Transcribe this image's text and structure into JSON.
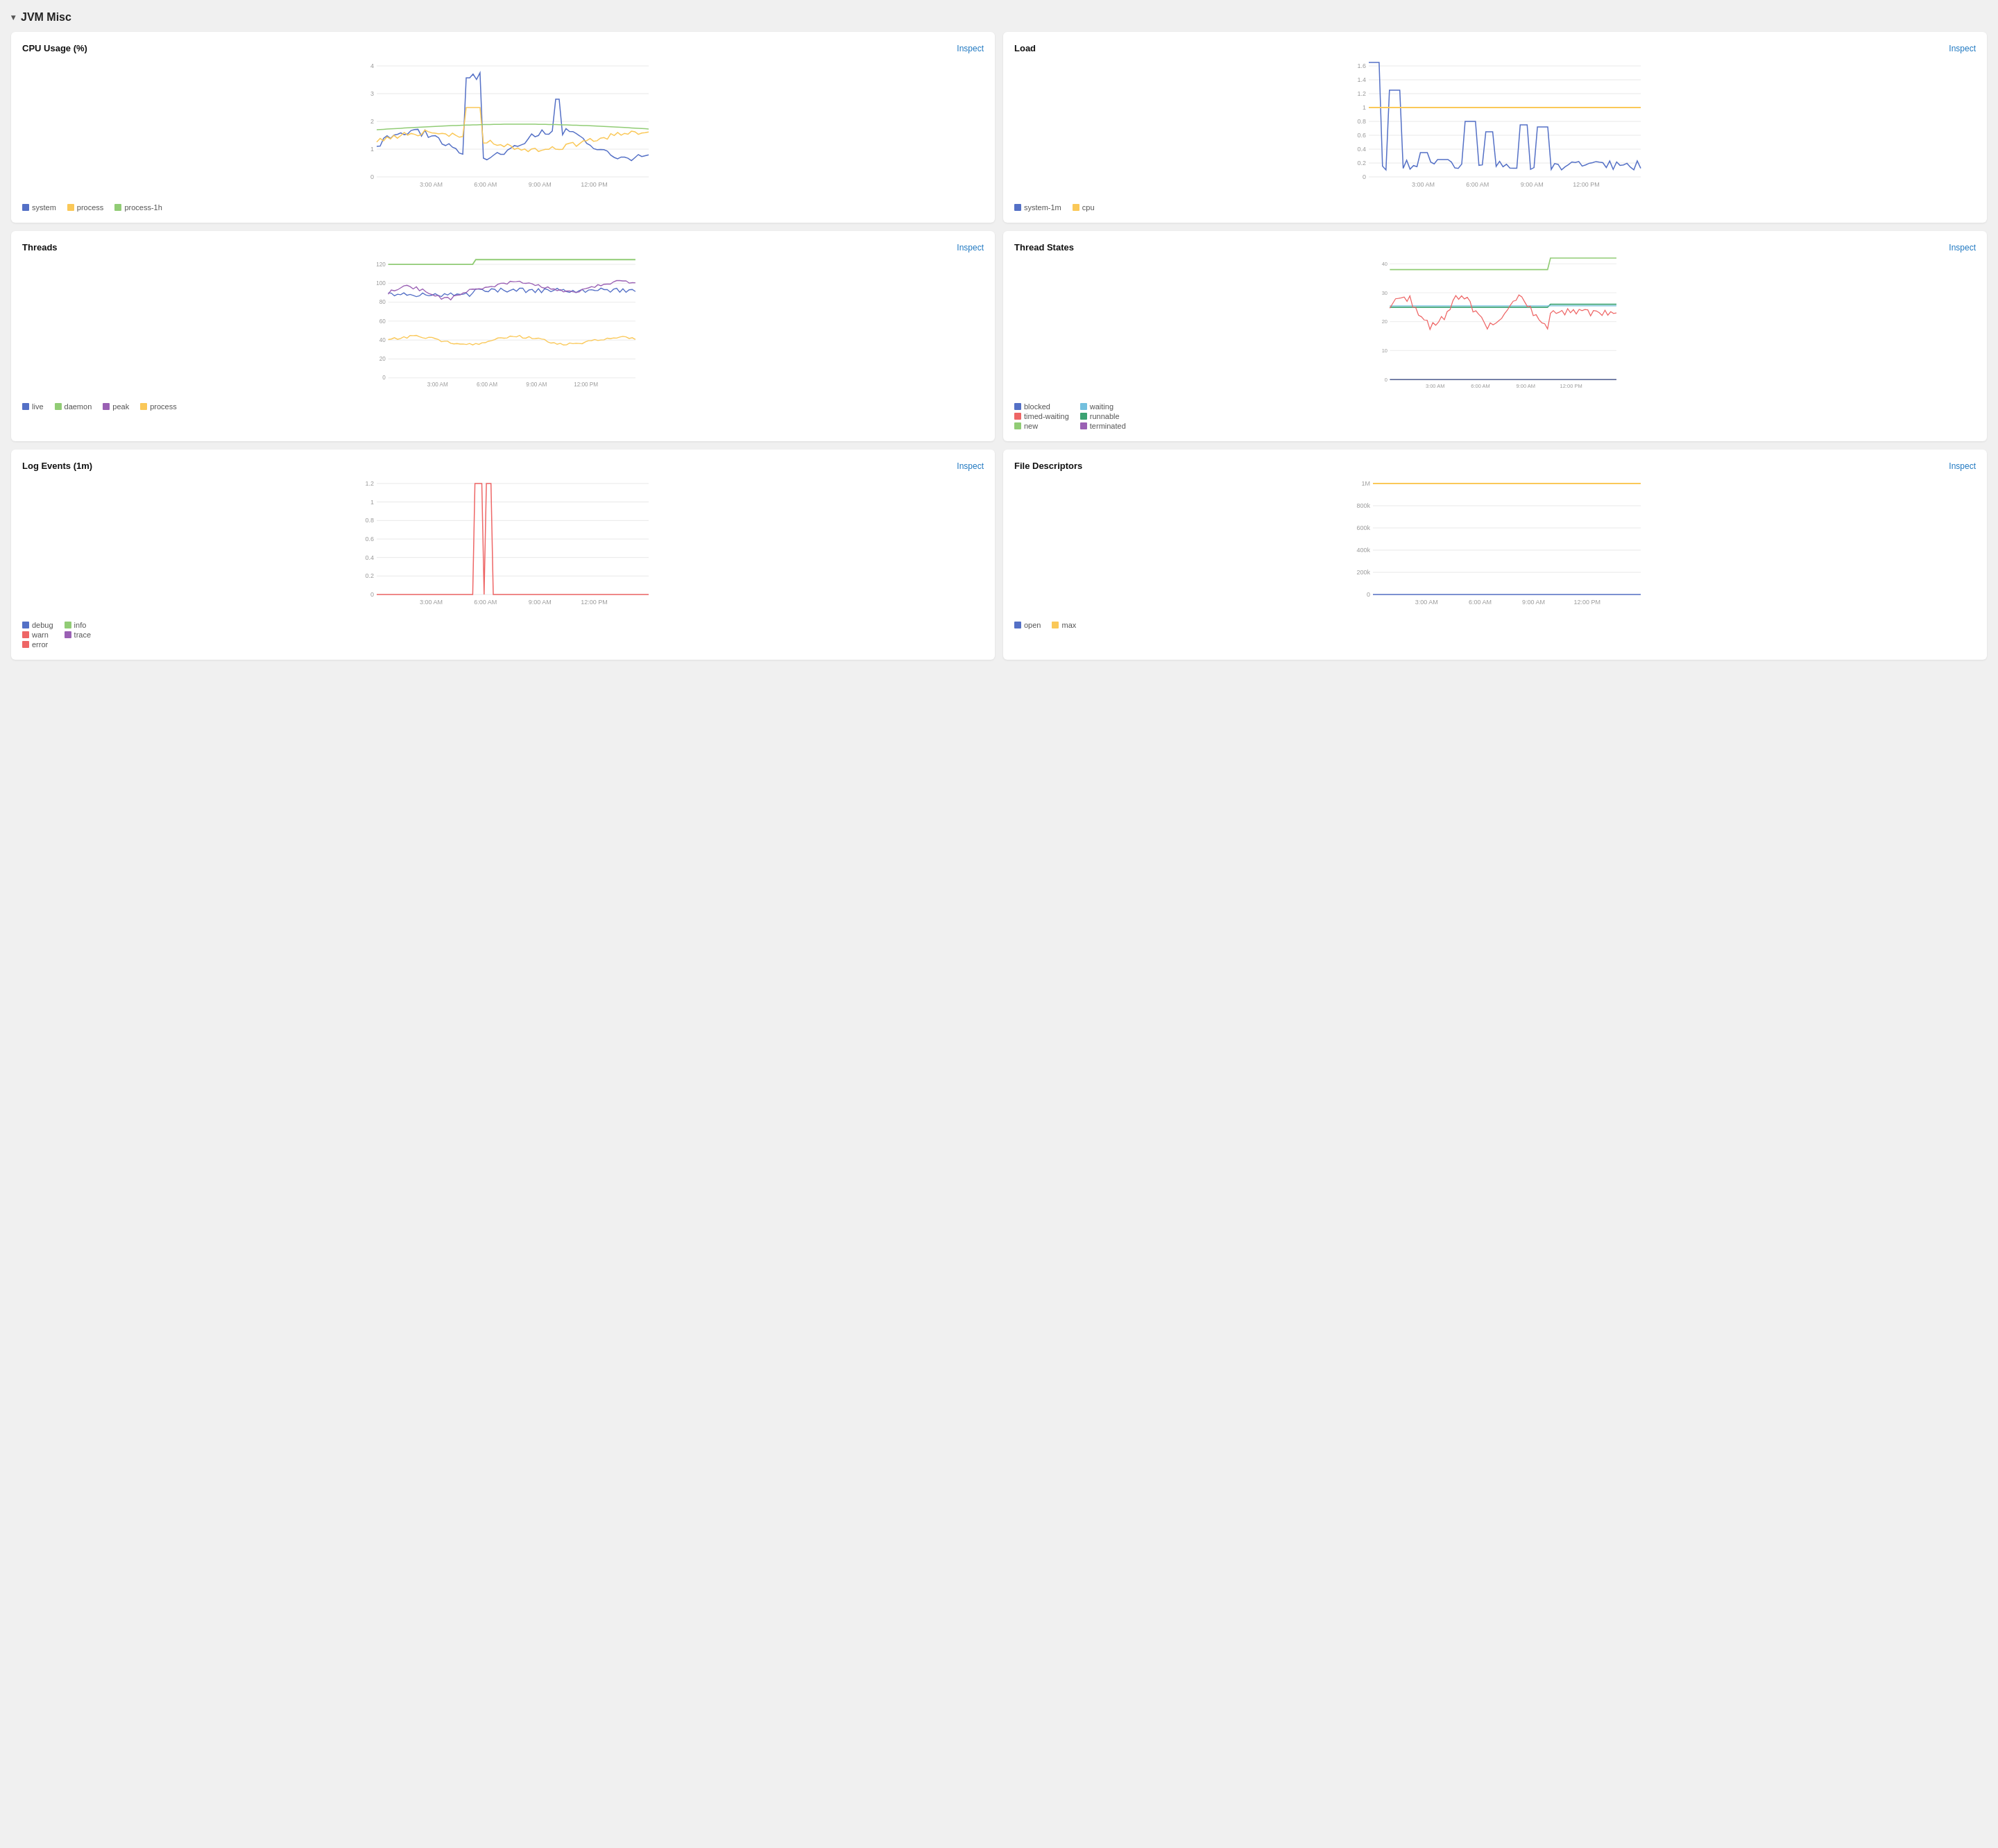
{
  "section": {
    "title": "JVM Misc",
    "chevron": "▾"
  },
  "cards": [
    {
      "id": "cpu-usage",
      "title": "CPU Usage (%)",
      "inspect_label": "Inspect",
      "y_max": 4,
      "y_ticks": [
        0,
        1,
        2,
        3,
        4
      ],
      "x_labels": [
        "3:00 AM",
        "6:00 AM",
        "9:00 AM",
        "12:00 PM"
      ],
      "legend": [
        {
          "label": "system",
          "color": "#5470c6"
        },
        {
          "label": "process",
          "color": "#91cc75"
        },
        {
          "label": "process-1h",
          "color": "#73c48f"
        }
      ]
    },
    {
      "id": "load",
      "title": "Load",
      "inspect_label": "Inspect",
      "y_max": 1.6,
      "y_ticks": [
        0,
        0.2,
        0.4,
        0.6,
        0.8,
        1.0,
        1.2,
        1.4,
        1.6
      ],
      "x_labels": [
        "3:00 AM",
        "6:00 AM",
        "9:00 AM",
        "12:00 PM"
      ],
      "legend": [
        {
          "label": "system-1m",
          "color": "#5470c6"
        },
        {
          "label": "cpu",
          "color": "#fac858"
        }
      ]
    },
    {
      "id": "threads",
      "title": "Threads",
      "inspect_label": "Inspect",
      "y_max": 120,
      "y_ticks": [
        0,
        20,
        40,
        60,
        80,
        100,
        120
      ],
      "x_labels": [
        "3:00 AM",
        "6:00 AM",
        "9:00 AM",
        "12:00 PM"
      ],
      "legend": [
        {
          "label": "live",
          "color": "#5470c6"
        },
        {
          "label": "daemon",
          "color": "#91cc75"
        },
        {
          "label": "peak",
          "color": "#9a60b4"
        },
        {
          "label": "process",
          "color": "#fac858"
        }
      ]
    },
    {
      "id": "thread-states",
      "title": "Thread States",
      "inspect_label": "Inspect",
      "y_max": 40,
      "y_ticks": [
        0,
        10,
        20,
        30,
        40
      ],
      "x_labels": [
        "3:00 AM",
        "6:00 AM",
        "9:00 AM",
        "12:00 PM"
      ],
      "legend": [
        {
          "label": "blocked",
          "color": "#5470c6"
        },
        {
          "label": "timed-waiting",
          "color": "#ee6666"
        },
        {
          "label": "new",
          "color": "#91cc75"
        },
        {
          "label": "waiting",
          "color": "#73c0de"
        },
        {
          "label": "runnable",
          "color": "#3ba272"
        },
        {
          "label": "terminated",
          "color": "#9a60b4"
        }
      ]
    },
    {
      "id": "log-events",
      "title": "Log Events (1m)",
      "inspect_label": "Inspect",
      "y_max": 1.2,
      "y_ticks": [
        0,
        0.2,
        0.4,
        0.6,
        0.8,
        1.0,
        1.2
      ],
      "x_labels": [
        "3:00 AM",
        "6:00 AM",
        "9:00 AM",
        "12:00 PM"
      ],
      "legend": [
        {
          "label": "debug",
          "color": "#5470c6"
        },
        {
          "label": "warn",
          "color": "#ee6666"
        },
        {
          "label": "error",
          "color": "#ee6666"
        },
        {
          "label": "info",
          "color": "#91cc75"
        },
        {
          "label": "trace",
          "color": "#9a60b4"
        }
      ]
    },
    {
      "id": "file-descriptors",
      "title": "File Descriptors",
      "inspect_label": "Inspect",
      "y_max": 1000000,
      "y_ticks": [
        0,
        200000,
        400000,
        600000,
        800000,
        1000000
      ],
      "y_labels": [
        "0",
        "200k",
        "400k",
        "600k",
        "800k",
        "1M"
      ],
      "x_labels": [
        "3:00 AM",
        "6:00 AM",
        "9:00 AM",
        "12:00 PM"
      ],
      "legend": [
        {
          "label": "open",
          "color": "#5470c6"
        },
        {
          "label": "max",
          "color": "#fac858"
        }
      ]
    }
  ]
}
